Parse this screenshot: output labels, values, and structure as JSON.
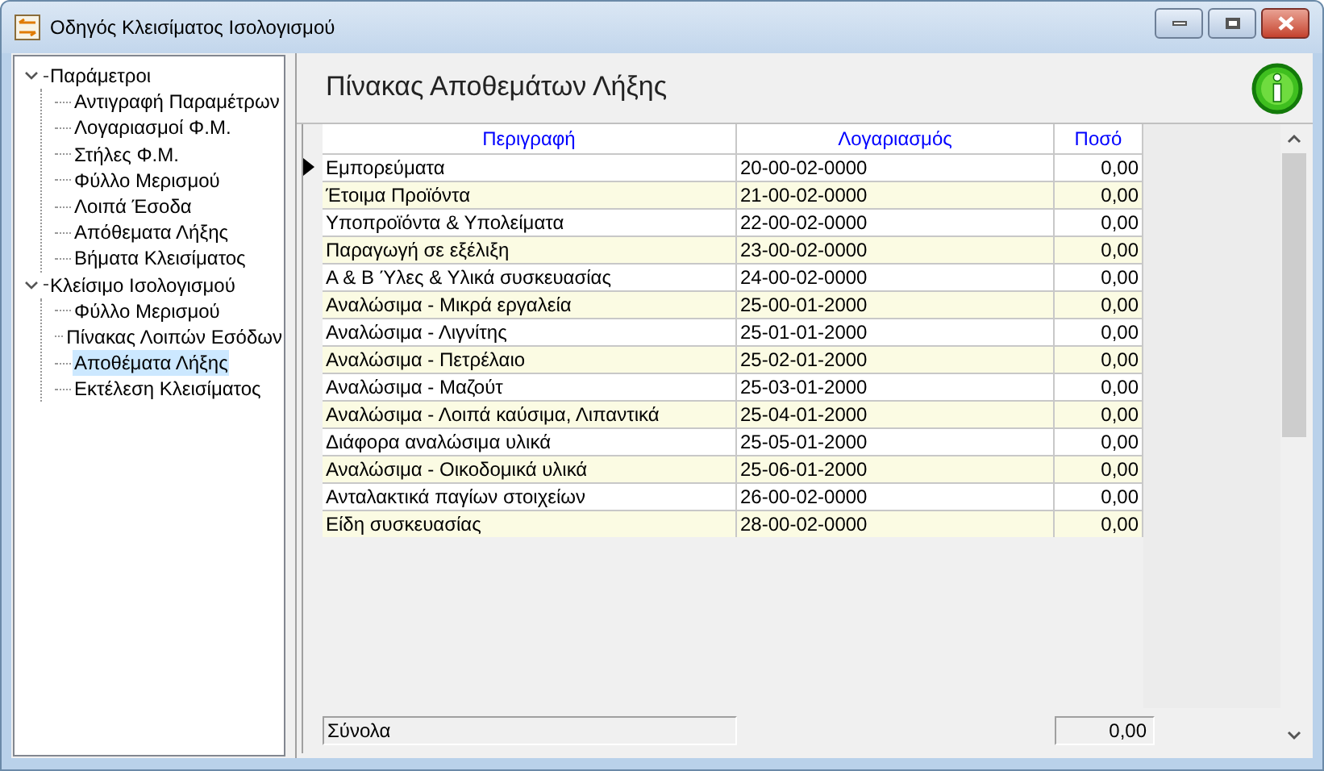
{
  "window": {
    "title": "Οδηγός Κλεισίματος Ισολογισμού"
  },
  "tree": [
    {
      "label": "Παράμετροι",
      "expanded": true,
      "selected": false,
      "children": [
        {
          "label": "Αντιγραφή Παραμέτρων",
          "selected": false
        },
        {
          "label": "Λογαριασμοί Φ.Μ.",
          "selected": false
        },
        {
          "label": "Στήλες Φ.Μ.",
          "selected": false
        },
        {
          "label": "Φύλλο Μερισμού",
          "selected": false
        },
        {
          "label": "Λοιπά Έσοδα",
          "selected": false
        },
        {
          "label": "Απόθεματα Λήξης",
          "selected": false
        },
        {
          "label": "Βήματα Κλεισίματος",
          "selected": false
        }
      ]
    },
    {
      "label": "Κλείσιμο Ισολογισμού",
      "expanded": true,
      "selected": false,
      "children": [
        {
          "label": "Φύλλο Μερισμού",
          "selected": false
        },
        {
          "label": "Πίνακας Λοιπών Εσόδων",
          "selected": false
        },
        {
          "label": "Αποθέματα Λήξης",
          "selected": true
        },
        {
          "label": "Εκτέλεση Κλεισίματος",
          "selected": false
        }
      ]
    }
  ],
  "page_title": "Πίνακας Αποθεμάτων Λήξης",
  "table": {
    "columns": [
      "Περιγραφή",
      "Λογαριασμός",
      "Ποσό"
    ],
    "rows": [
      {
        "cells": [
          "Εμπορεύματα",
          "20-00-02-0000",
          "0,00"
        ],
        "selected": true
      },
      {
        "cells": [
          "Έτοιμα Προϊόντα",
          "21-00-02-0000",
          "0,00"
        ],
        "selected": false
      },
      {
        "cells": [
          "Υποπροϊόντα & Υπολείματα",
          "22-00-02-0000",
          "0,00"
        ],
        "selected": false
      },
      {
        "cells": [
          "Παραγωγή σε εξέλιξη",
          "23-00-02-0000",
          "0,00"
        ],
        "selected": false
      },
      {
        "cells": [
          "Α & Β Ύλες & Υλικά συσκευασίας",
          "24-00-02-0000",
          "0,00"
        ],
        "selected": false
      },
      {
        "cells": [
          "Αναλώσιμα - Μικρά εργαλεία",
          "25-00-01-2000",
          "0,00"
        ],
        "selected": false
      },
      {
        "cells": [
          "Αναλώσιμα - Λιγνίτης",
          "25-01-01-2000",
          "0,00"
        ],
        "selected": false
      },
      {
        "cells": [
          "Αναλώσιμα - Πετρέλαιο",
          "25-02-01-2000",
          "0,00"
        ],
        "selected": false
      },
      {
        "cells": [
          "Αναλώσιμα - Μαζούτ",
          "25-03-01-2000",
          "0,00"
        ],
        "selected": false
      },
      {
        "cells": [
          "Αναλώσιμα - Λοιπά καύσιμα, Λιπαντικά",
          "25-04-01-2000",
          "0,00"
        ],
        "selected": false
      },
      {
        "cells": [
          "Διάφορα αναλώσιμα υλικά",
          "25-05-01-2000",
          "0,00"
        ],
        "selected": false
      },
      {
        "cells": [
          "Αναλώσιμα - Οικοδομικά υλικά",
          "25-06-01-2000",
          "0,00"
        ],
        "selected": false
      },
      {
        "cells": [
          "Ανταλακτικά παγίων στοιχείων",
          "26-00-02-0000",
          "0,00"
        ],
        "selected": false
      },
      {
        "cells": [
          "Είδη συσκευασίας",
          "28-00-02-0000",
          "0,00"
        ],
        "selected": false
      }
    ]
  },
  "totals": {
    "label": "Σύνολα",
    "amount": "0,00"
  }
}
